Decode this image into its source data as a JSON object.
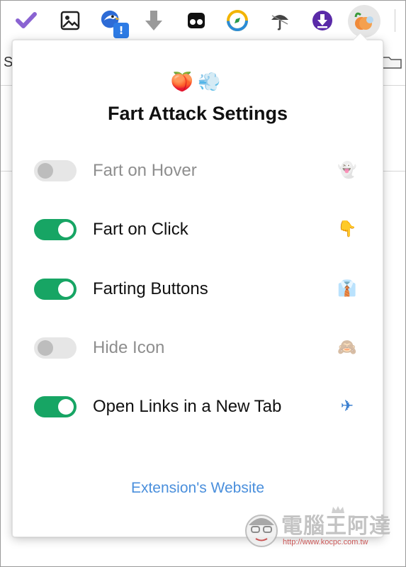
{
  "toolbar": {
    "icons": [
      {
        "name": "checkmark-extension-icon",
        "glyph": "✔",
        "color": "#8a63d2"
      },
      {
        "name": "image-extension-icon",
        "glyph": "🖼",
        "color": "#222222"
      },
      {
        "name": "eagle-extension-icon",
        "glyph": "🦅",
        "color": "#2d6bd6",
        "badge": "!"
      },
      {
        "name": "download-arrow-extension-icon",
        "glyph": "⬇",
        "color": "#9a9a9a"
      },
      {
        "name": "ghost-extension-icon",
        "glyph": "👓",
        "color": "#111111"
      },
      {
        "name": "compass-extension-icon",
        "glyph": "🧭",
        "color": "#2a8cd8"
      },
      {
        "name": "umbrella-extension-icon",
        "glyph": "☂",
        "color": "#555555"
      },
      {
        "name": "download-circle-extension-icon",
        "glyph": "⬇",
        "color": "#5a2aa8"
      },
      {
        "name": "fart-attack-extension-icon",
        "glyph": "🍑",
        "color": "#e8823a"
      }
    ]
  },
  "popup": {
    "logo": "🍑💨",
    "title": "Fart Attack Settings",
    "settings": [
      {
        "label": "Fart on Hover",
        "enabled": false,
        "emoji": "👻"
      },
      {
        "label": "Fart on Click",
        "enabled": true,
        "emoji": "👇"
      },
      {
        "label": "Farting Buttons",
        "enabled": true,
        "emoji": "👔"
      },
      {
        "label": "Hide Icon",
        "enabled": false,
        "emoji": "🙈"
      },
      {
        "label": "Open Links in a New Tab",
        "enabled": true,
        "emoji": "✈"
      }
    ],
    "website_link": "Extension's Website"
  },
  "watermark": {
    "text": "電腦王阿達",
    "url": "http://www.kocpc.com.tw"
  },
  "colors": {
    "toggle_on": "#17a564",
    "toggle_off": "#e6e6e6",
    "link": "#4a8fdc"
  }
}
